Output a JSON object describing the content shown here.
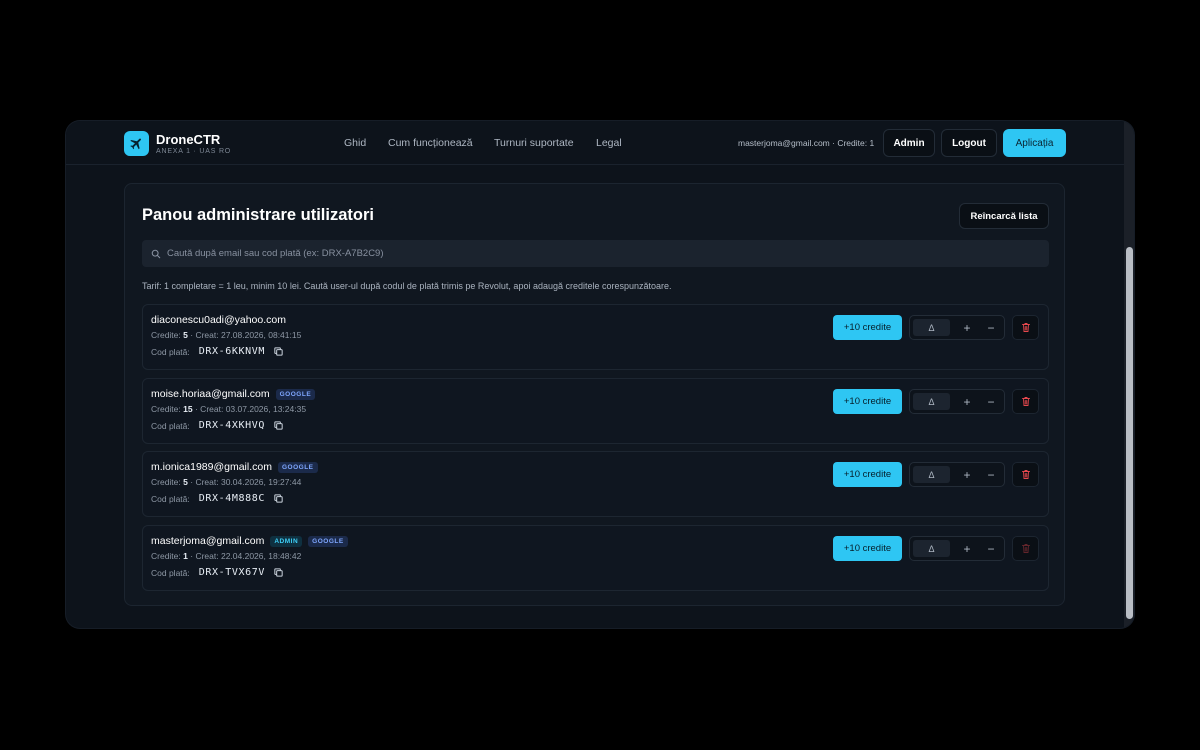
{
  "brand": {
    "name": "DroneCTR",
    "subtitle": "ANEXA 1 · UAS RO"
  },
  "nav": [
    "Ghid",
    "Cum funcționează",
    "Turnuri suportate",
    "Legal"
  ],
  "header": {
    "user_info": "masterjoma@gmail.com · Credite: 1",
    "admin_label": "Admin",
    "logout_label": "Logout",
    "app_label": "Aplicația"
  },
  "panel": {
    "title": "Panou administrare utilizatori",
    "reload_label": "Reîncarcă lista",
    "search_placeholder": "Caută după email sau cod plată (ex: DRX-A7B2C9)",
    "search_value": "",
    "tariff": "Tarif: 1 completare = 1 leu, minim 10 lei. Caută user-ul după codul de plată trimis pe Revolut, apoi adaugă creditele corespunzătoare."
  },
  "labels": {
    "credits_prefix": "Credite:",
    "created_prefix": "· Creat:",
    "code_prefix": "Cod plată:",
    "add_credits": "+10 credite",
    "stepper_value": "Δ",
    "plus": "+",
    "minus": "−"
  },
  "users": [
    {
      "email": "diaconescu0adi@yahoo.com",
      "badges": [],
      "credits": "5",
      "created": "27.08.2026, 08:41:15",
      "code": "DRX-6KKNVM",
      "delete_disabled": false
    },
    {
      "email": "moise.horiaa@gmail.com",
      "badges": [
        "GOOGLE"
      ],
      "credits": "15",
      "created": "03.07.2026, 13:24:35",
      "code": "DRX-4XKHVQ",
      "delete_disabled": false
    },
    {
      "email": "m.ionica1989@gmail.com",
      "badges": [
        "GOOGLE"
      ],
      "credits": "5",
      "created": "30.04.2026, 19:27:44",
      "code": "DRX-4M888C",
      "delete_disabled": false
    },
    {
      "email": "masterjoma@gmail.com",
      "badges": [
        "ADMIN",
        "GOOGLE"
      ],
      "credits": "1",
      "created": "22.04.2026, 18:48:42",
      "code": "DRX-TVX67V",
      "delete_disabled": true
    }
  ],
  "colors": {
    "accent": "#2ec6f3",
    "danger": "#e5484d",
    "background": "#0d131b"
  }
}
